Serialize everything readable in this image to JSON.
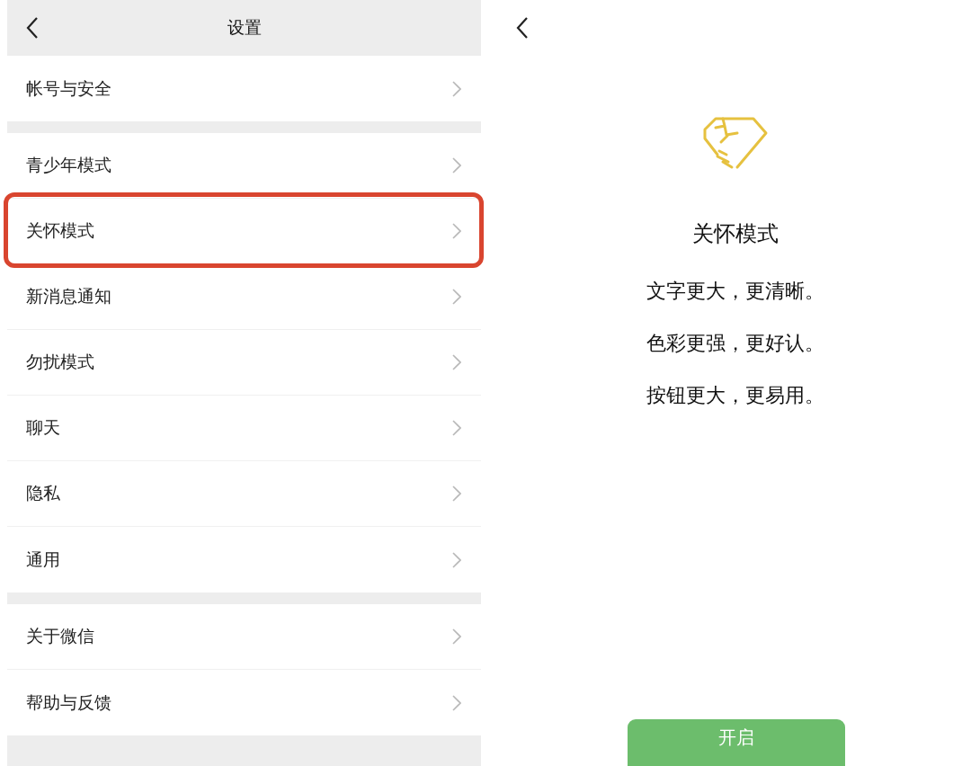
{
  "settings": {
    "title": "设置",
    "groups": [
      {
        "items": [
          {
            "label": "帐号与安全",
            "highlighted": false
          }
        ]
      },
      {
        "items": [
          {
            "label": "青少年模式",
            "highlighted": false
          },
          {
            "label": "关怀模式",
            "highlighted": true
          },
          {
            "label": "新消息通知",
            "highlighted": false
          },
          {
            "label": "勿扰模式",
            "highlighted": false
          },
          {
            "label": "聊天",
            "highlighted": false
          },
          {
            "label": "隐私",
            "highlighted": false
          },
          {
            "label": "通用",
            "highlighted": false
          }
        ]
      },
      {
        "items": [
          {
            "label": "关于微信",
            "highlighted": false
          },
          {
            "label": "帮助与反馈",
            "highlighted": false
          }
        ]
      }
    ]
  },
  "care_mode": {
    "title": "关怀模式",
    "lines": [
      "文字更大，更清晰。",
      "色彩更强，更好认。",
      "按钮更大，更易用。"
    ],
    "button": "开启"
  }
}
